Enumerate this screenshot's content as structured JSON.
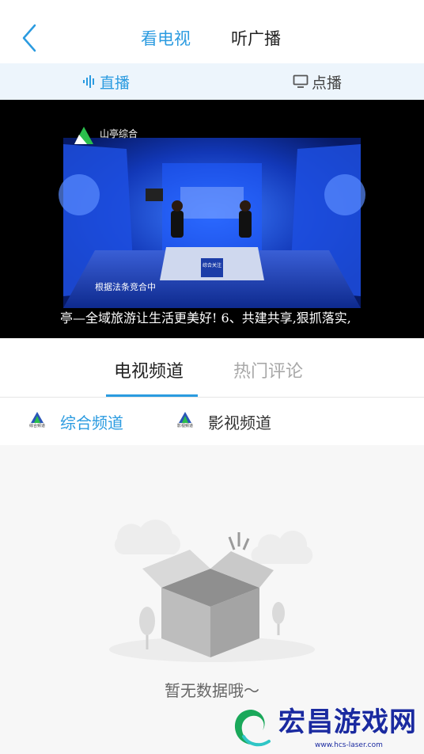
{
  "header": {
    "tabs": [
      {
        "label": "看电视",
        "active": true
      },
      {
        "label": "听广播",
        "active": false
      }
    ]
  },
  "subnav": {
    "live_label": "直播",
    "vod_label": "点播"
  },
  "video": {
    "station_logo_text": "山亭综合",
    "lower_caption": "根据法条竞合中",
    "ticker": "亭—全域旅游让生活更美好! 6、共建共享,狠抓落实,",
    "desk_sign": "综合关注"
  },
  "content_tabs": {
    "tabs": [
      {
        "label": "电视频道",
        "active": true
      },
      {
        "label": "热门评论",
        "active": false
      }
    ]
  },
  "channels": [
    {
      "label": "综合频道",
      "logo_caption": "综合频道",
      "selected": true
    },
    {
      "label": "影视频道",
      "logo_caption": "影视频道",
      "selected": false
    }
  ],
  "empty_state": {
    "message": "暂无数据哦～"
  },
  "watermark": {
    "title": "宏昌游戏网",
    "url": "www.hcs-laser.com"
  },
  "colors": {
    "accent": "#2b9be0",
    "subbar_bg": "#edf5fc",
    "watermark": "#1a2aa0"
  }
}
